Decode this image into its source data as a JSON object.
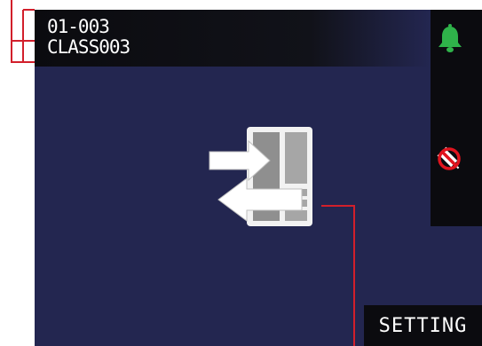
{
  "header": {
    "device_id": "01-003",
    "device_class": "CLASS003"
  },
  "side_panel": {
    "icons": [
      "bell-icon",
      "no-syringe-icon"
    ],
    "bell_color": "#2fb34a"
  },
  "main": {
    "icon": "data-transfer-icon"
  },
  "footer": {
    "setting_label": "SETTING"
  },
  "colors": {
    "screen_background": "#232650",
    "bar_background": "#0b0b0f",
    "callout_line": "#d21f2b"
  }
}
